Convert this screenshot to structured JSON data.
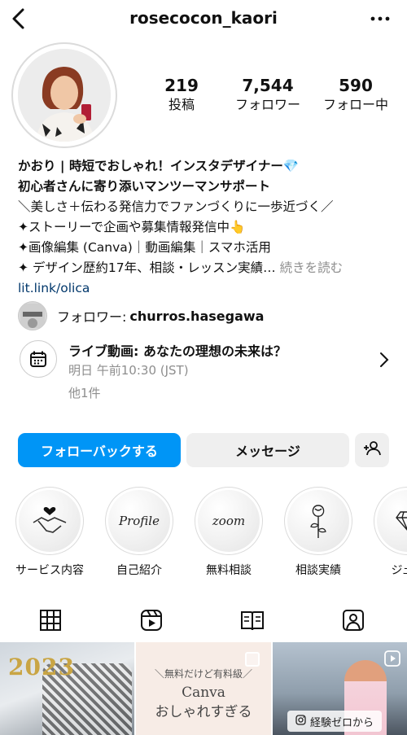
{
  "header": {
    "username": "rosecocon_kaori"
  },
  "stats": [
    {
      "count": "219",
      "label": "投稿"
    },
    {
      "count": "7,544",
      "label": "フォロワー"
    },
    {
      "count": "590",
      "label": "フォロー中"
    }
  ],
  "bio": {
    "name_line": "かおり | 時短でおしゃれ！インスタデザイナー💎",
    "line2": "初心者さんに寄り添いマンツーマンサポート",
    "line3": "＼美しさ＋伝わる発信力でファンづくりに一歩近づく／",
    "line4": "✦ストーリーで企画や募集情報発信中👆",
    "line5": "✦画像編集 (Canva)｜動画編集｜スマホ活用",
    "line6": "✦ デザイン歴約17年、相談・レッスン実績…",
    "more": "続きを読む",
    "link": "lit.link/olica"
  },
  "followed_by": {
    "prefix": "フォロワー:",
    "name": "churros.hasegawa"
  },
  "event": {
    "title": "ライブ動画: あなたの理想の未来は？",
    "time": "明日 午前10:30 (JST)",
    "more": "他1件"
  },
  "buttons": {
    "follow_back": "フォローバックする",
    "message": "メッセージ"
  },
  "highlights": [
    {
      "label": "サービス内容",
      "inner": ""
    },
    {
      "label": "自己紹介",
      "inner": "Profile"
    },
    {
      "label": "無料相談",
      "inner": "zoom"
    },
    {
      "label": "相談実績",
      "inner": ""
    },
    {
      "label": "ジュエ",
      "inner": ""
    }
  ],
  "grid": {
    "post1_text": "2023",
    "post2_sub": "＼無料だけど有料級／",
    "post2_line1": "Canva",
    "post2_line2": "おしゃれすぎる",
    "post3_caption": "経験ゼロから"
  },
  "colors": {
    "accent": "#0095f6",
    "link": "#00376b",
    "muted": "#8e8e8e"
  }
}
